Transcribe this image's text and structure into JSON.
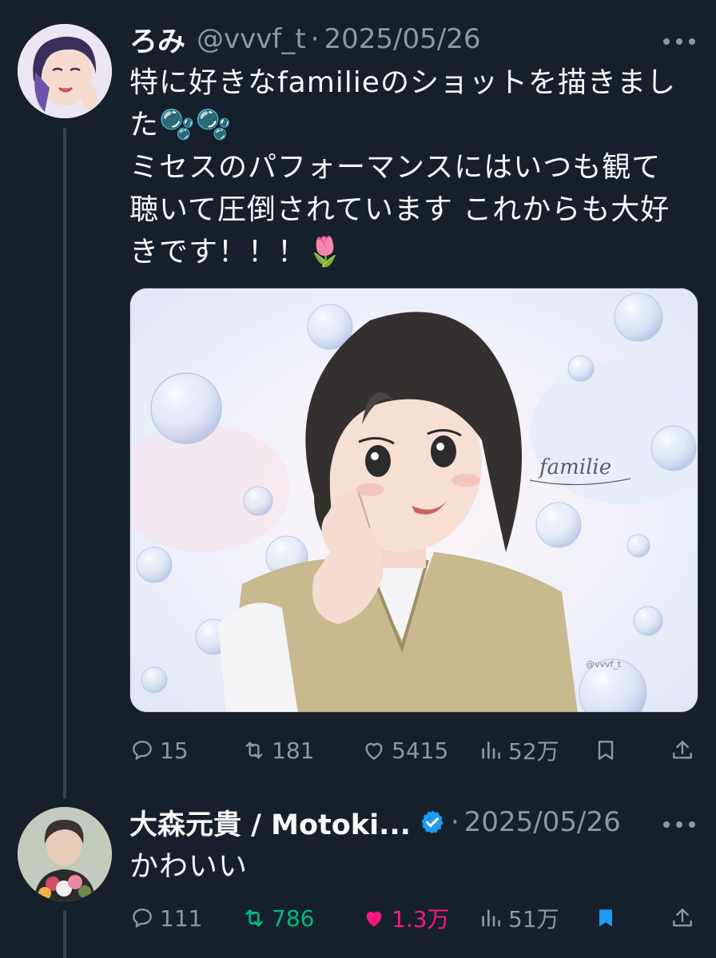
{
  "tweet1": {
    "name": "ろみ",
    "handle": "@vvvf_t",
    "separator": "·",
    "date": "2025/05/26",
    "lines": [
      "特に好きなfamilieのショットを描きまし",
      "た🫧🫧",
      "ミセスのパフォーマンスにはいつも観て",
      "聴いて圧倒されています これからも大好",
      "きです！！！🌷"
    ],
    "image_text": {
      "signature": "familie",
      "watermark": "@vvvf_t"
    },
    "actions": {
      "replies": "15",
      "retweets": "181",
      "likes": "5415",
      "views": "52万"
    }
  },
  "tweet2": {
    "name": "大森元貴 / Motoki...",
    "separator": "·",
    "date": "2025/05/26",
    "text": "かわいい",
    "actions": {
      "replies": "111",
      "retweets": "786",
      "likes": "1.3万",
      "views": "51万"
    },
    "state": {
      "retweeted": true,
      "liked": true,
      "bookmarked": true
    }
  },
  "colors": {
    "background": "#15202b",
    "muted": "#8b98a5",
    "text": "#f7f9f9",
    "retweet_active": "#00ba7c",
    "like_active": "#f91880",
    "bookmark_active": "#1d9bf0",
    "verified": "#1d9bf0"
  },
  "icons": [
    "reply-icon",
    "retweet-icon",
    "like-icon",
    "views-icon",
    "bookmark-icon",
    "share-icon",
    "more-icon",
    "verified-badge-icon"
  ]
}
